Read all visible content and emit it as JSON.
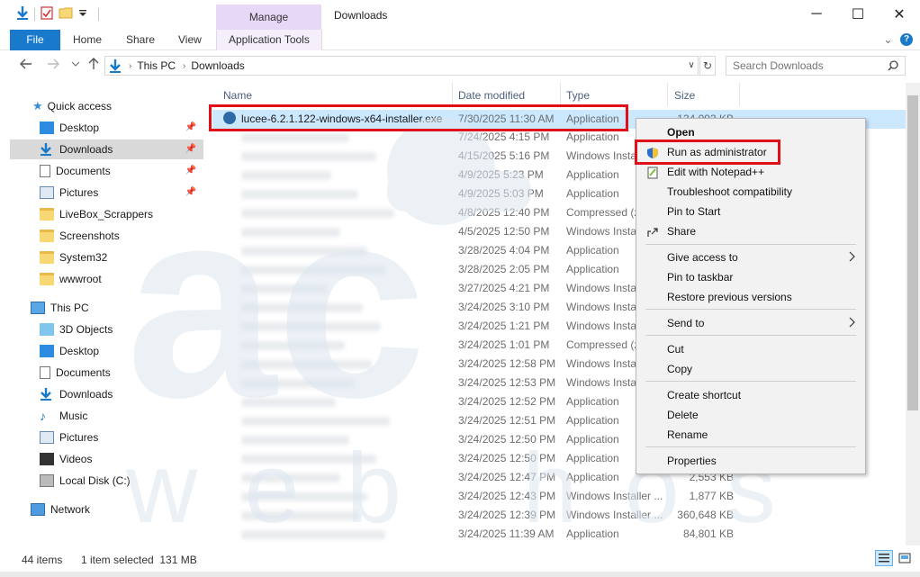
{
  "window": {
    "title": "Downloads",
    "manage_tab": "Manage",
    "controls": {
      "minimize": "─",
      "maximize": "☐",
      "close": "✕"
    }
  },
  "ribbon": {
    "file": "File",
    "tabs": [
      "Home",
      "Share",
      "View"
    ],
    "application_tools": "Application Tools",
    "expand_glyph": "⌄",
    "help_glyph": "?"
  },
  "address": {
    "crumbs": [
      "This PC",
      "Downloads"
    ],
    "search_placeholder": "Search Downloads"
  },
  "navigation": {
    "quick_access": "Quick access",
    "quick_items": [
      "Desktop",
      "Downloads",
      "Documents",
      "Pictures",
      "LiveBox_Scrappers",
      "Screenshots",
      "System32",
      "wwwroot"
    ],
    "this_pc": "This PC",
    "pc_items": [
      "3D Objects",
      "Desktop",
      "Documents",
      "Downloads",
      "Music",
      "Pictures",
      "Videos",
      "Local Disk (C:)"
    ],
    "network": "Network"
  },
  "columns": {
    "name": "Name",
    "date": "Date modified",
    "type": "Type",
    "size": "Size"
  },
  "files": [
    {
      "name": "lucee-6.2.1.122-windows-x64-installer.exe",
      "date": "7/30/2025 11:30 AM",
      "type": "Application",
      "size": "134,093 KB"
    },
    {
      "name": "",
      "date": "7/24/2025 4:15 PM",
      "type": "Application",
      "size": ""
    },
    {
      "name": "",
      "date": "4/15/2025 5:16 PM",
      "type": "Windows Insta",
      "size": ""
    },
    {
      "name": "",
      "date": "4/9/2025 5:23 PM",
      "type": "Application",
      "size": ""
    },
    {
      "name": "",
      "date": "4/9/2025 5:03 PM",
      "type": "Application",
      "size": ""
    },
    {
      "name": "",
      "date": "4/8/2025 12:40 PM",
      "type": "Compressed (z",
      "size": ""
    },
    {
      "name": "",
      "date": "4/5/2025 12:50 PM",
      "type": "Windows Insta",
      "size": ""
    },
    {
      "name": "",
      "date": "3/28/2025 4:04 PM",
      "type": "Application",
      "size": ""
    },
    {
      "name": "",
      "date": "3/28/2025 2:05 PM",
      "type": "Application",
      "size": ""
    },
    {
      "name": "",
      "date": "3/27/2025 4:21 PM",
      "type": "Windows Insta",
      "size": ""
    },
    {
      "name": "",
      "date": "3/24/2025 3:10 PM",
      "type": "Windows Insta",
      "size": ""
    },
    {
      "name": "",
      "date": "3/24/2025 1:21 PM",
      "type": "Windows Insta",
      "size": ""
    },
    {
      "name": "",
      "date": "3/24/2025 1:01 PM",
      "type": "Compressed (z",
      "size": ""
    },
    {
      "name": "",
      "date": "3/24/2025 12:58 PM",
      "type": "Windows Insta",
      "size": ""
    },
    {
      "name": "",
      "date": "3/24/2025 12:53 PM",
      "type": "Windows Insta",
      "size": ""
    },
    {
      "name": "",
      "date": "3/24/2025 12:52 PM",
      "type": "Application",
      "size": ""
    },
    {
      "name": "",
      "date": "3/24/2025 12:51 PM",
      "type": "Application",
      "size": ""
    },
    {
      "name": "",
      "date": "3/24/2025 12:50 PM",
      "type": "Application",
      "size": ""
    },
    {
      "name": "",
      "date": "3/24/2025 12:50 PM",
      "type": "Application",
      "size": ""
    },
    {
      "name": "",
      "date": "3/24/2025 12:47 PM",
      "type": "Application",
      "size": "2,553 KB"
    },
    {
      "name": "",
      "date": "3/24/2025 12:43 PM",
      "type": "Windows Installer ...",
      "size": "1,877 KB"
    },
    {
      "name": "",
      "date": "3/24/2025 12:39 PM",
      "type": "Windows Installer ...",
      "size": "360,648 KB"
    },
    {
      "name": "",
      "date": "3/24/2025 11:39 AM",
      "type": "Application",
      "size": "84,801 KB"
    }
  ],
  "context_menu": [
    {
      "label": "Open",
      "bold": true
    },
    {
      "label": "Run as administrator",
      "icon": "shield-icon"
    },
    {
      "label": "Edit with Notepad++",
      "icon": "notepad-icon"
    },
    {
      "label": "Troubleshoot compatibility"
    },
    {
      "label": "Pin to Start"
    },
    {
      "label": "Share",
      "icon": "share-icon"
    },
    {
      "label": "Give access to",
      "submenu": true
    },
    {
      "label": "Pin to taskbar"
    },
    {
      "label": "Restore previous versions"
    },
    {
      "label": "Send to",
      "submenu": true
    },
    {
      "label": "Cut"
    },
    {
      "label": "Copy"
    },
    {
      "label": "Create shortcut"
    },
    {
      "label": "Delete"
    },
    {
      "label": "Rename"
    },
    {
      "label": "Properties"
    }
  ],
  "status": {
    "items": "44 items",
    "selected": "1 item selected  131 MB"
  },
  "watermark": {
    "brand": "ac",
    "tagline": "web hosting"
  },
  "colors": {
    "accent": "#1979ca",
    "selection": "#cce8ff",
    "highlight": "#e0101a",
    "manage": "#e8d8f7"
  }
}
